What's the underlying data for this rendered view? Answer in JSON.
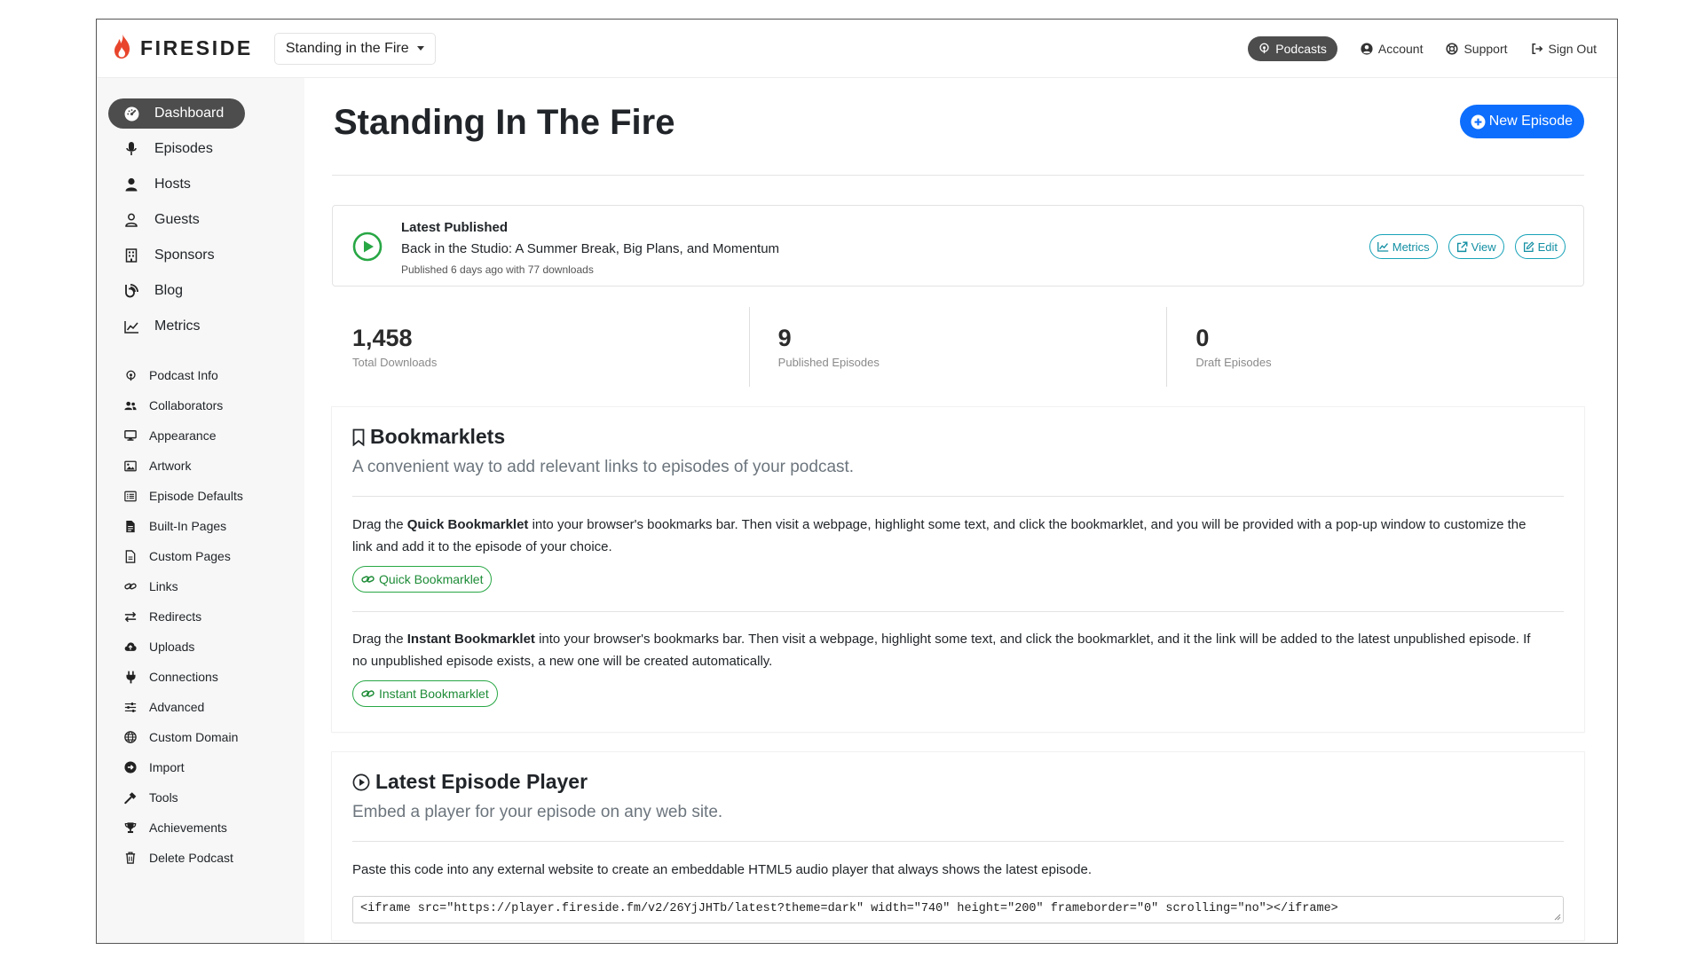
{
  "brand": {
    "name": "FIRESIDE"
  },
  "podcast_selector": {
    "value": "Standing in the Fire"
  },
  "topnav": {
    "items": [
      {
        "label": "Podcasts",
        "icon": "podcast-icon",
        "active": true
      },
      {
        "label": "Account",
        "icon": "user-circle-icon"
      },
      {
        "label": "Support",
        "icon": "lifebuoy-icon"
      },
      {
        "label": "Sign Out",
        "icon": "sign-out-icon"
      }
    ]
  },
  "sidebar": {
    "main": [
      {
        "label": "Dashboard",
        "icon": "dashboard-icon",
        "active": true
      },
      {
        "label": "Episodes",
        "icon": "microphone-icon"
      },
      {
        "label": "Hosts",
        "icon": "user-icon"
      },
      {
        "label": "Guests",
        "icon": "user-outline-icon"
      },
      {
        "label": "Sponsors",
        "icon": "building-icon"
      },
      {
        "label": "Blog",
        "icon": "blog-icon"
      },
      {
        "label": "Metrics",
        "icon": "chart-line-icon"
      }
    ],
    "settings": [
      {
        "label": "Podcast Info",
        "icon": "podcast-icon"
      },
      {
        "label": "Collaborators",
        "icon": "users-icon"
      },
      {
        "label": "Appearance",
        "icon": "desktop-icon"
      },
      {
        "label": "Artwork",
        "icon": "image-icon"
      },
      {
        "label": "Episode Defaults",
        "icon": "list-icon"
      },
      {
        "label": "Built-In Pages",
        "icon": "file-icon"
      },
      {
        "label": "Custom Pages",
        "icon": "file-outline-icon"
      },
      {
        "label": "Links",
        "icon": "link-icon"
      },
      {
        "label": "Redirects",
        "icon": "arrows-icon"
      },
      {
        "label": "Uploads",
        "icon": "cloud-upload-icon"
      },
      {
        "label": "Connections",
        "icon": "plug-icon"
      },
      {
        "label": "Advanced",
        "icon": "sliders-icon"
      },
      {
        "label": "Custom Domain",
        "icon": "globe-icon"
      },
      {
        "label": "Import",
        "icon": "import-icon"
      },
      {
        "label": "Tools",
        "icon": "hammer-icon"
      },
      {
        "label": "Achievements",
        "icon": "trophy-icon"
      },
      {
        "label": "Delete Podcast",
        "icon": "trash-icon"
      }
    ]
  },
  "page": {
    "title": "Standing In The Fire",
    "new_episode_label": "New Episode"
  },
  "latest": {
    "label": "Latest Published",
    "title": "Back in the Studio: A Summer Break, Big Plans, and Momentum",
    "meta": "Published 6 days ago with 77 downloads",
    "actions": {
      "metrics": "Metrics",
      "view": "View",
      "edit": "Edit"
    }
  },
  "stats": [
    {
      "value": "1,458",
      "caption": "Total Downloads"
    },
    {
      "value": "9",
      "caption": "Published Episodes"
    },
    {
      "value": "0",
      "caption": "Draft Episodes"
    }
  ],
  "bookmarklets": {
    "title": "Bookmarklets",
    "subtitle": "A convenient way to add relevant links to episodes of your podcast.",
    "quick": {
      "pre": "Drag the ",
      "bold": "Quick Bookmarklet",
      "post": " into your browser's bookmarks bar. Then visit a webpage, highlight some text, and click the bookmarklet, and you will be provided with a pop-up window to customize the link and add it to the episode of your choice.",
      "button": "Quick Bookmarklet"
    },
    "instant": {
      "pre": "Drag the ",
      "bold": "Instant Bookmarklet",
      "post": " into your browser's bookmarks bar. Then visit a webpage, highlight some text, and click the bookmarklet, and it the link will be added to the latest unpublished episode. If no unpublished episode exists, a new one will be created automatically.",
      "button": "Instant Bookmarklet"
    }
  },
  "player": {
    "title": "Latest Episode Player",
    "subtitle": "Embed a player for your episode on any web site.",
    "instructions": "Paste this code into any external website to create an embeddable HTML5 audio player that always shows the latest episode.",
    "embed_code": "<iframe src=\"https://player.fireside.fm/v2/26YjJHTb/latest?theme=dark\" width=\"740\" height=\"200\" frameborder=\"0\" scrolling=\"no\"></iframe>"
  },
  "colors": {
    "brand_flame": "#e8452c",
    "primary": "#0d6efd",
    "info": "#17a2b8",
    "success": "#28a745",
    "active_nav": "#4d4d4d"
  }
}
